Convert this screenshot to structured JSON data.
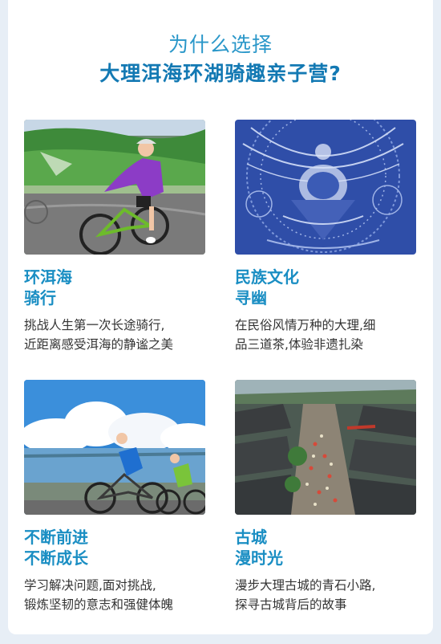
{
  "header": {
    "line1": "为什么选择",
    "line2": "大理洱海环湖骑趣亲子营?"
  },
  "features": [
    {
      "title1": "环洱海",
      "title2": "骑行",
      "desc1": "挑战人生第一次长途骑行,",
      "desc2": "近距离感受洱海的静谧之美"
    },
    {
      "title1": "民族文化",
      "title2": "寻幽",
      "desc1": "在民俗风情万种的大理,细",
      "desc2": "品三道茶,体验非遗扎染"
    },
    {
      "title1": "不断前进",
      "title2": "不断成长",
      "desc1": "学习解决问题,面对挑战,",
      "desc2": "锻炼坚韧的意志和强健体魄"
    },
    {
      "title1": "古城",
      "title2": "漫时光",
      "desc1": "漫步大理古城的青石小路,",
      "desc2": "探寻古城背后的故事"
    }
  ],
  "colors": {
    "title_blue": "#1a8ec3",
    "headline_blue": "#1379b3",
    "body_text": "#333333"
  }
}
